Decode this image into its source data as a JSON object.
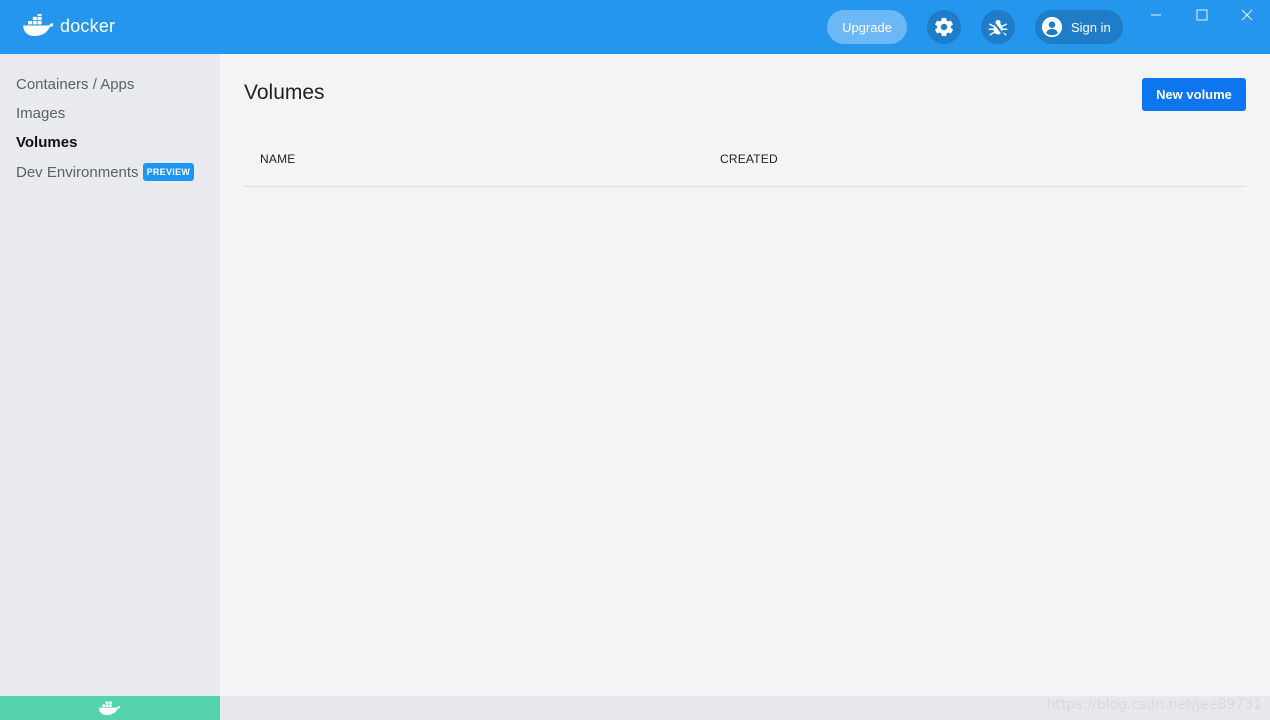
{
  "app": {
    "brand": "docker"
  },
  "titlebar": {
    "upgrade_label": "Upgrade",
    "signin_label": "Sign in",
    "settings_icon": "gear-icon",
    "bug_icon": "bug-icon"
  },
  "sidebar": {
    "items": [
      {
        "label": "Containers / Apps",
        "active": false
      },
      {
        "label": "Images",
        "active": false
      },
      {
        "label": "Volumes",
        "active": true
      },
      {
        "label": "Dev Environments",
        "active": false,
        "badge": "PREVIEW"
      }
    ]
  },
  "main": {
    "title": "Volumes",
    "new_button_label": "New volume",
    "table": {
      "columns": [
        "NAME",
        "CREATED"
      ],
      "rows": []
    }
  },
  "statusbar": {
    "watermark": "https://blog.csdn.net/jee89731"
  },
  "colors": {
    "titlebar": "#2496ed",
    "primary_button": "#0d75ef",
    "status_green": "#53d2ab",
    "badge": "#1d96f3"
  }
}
